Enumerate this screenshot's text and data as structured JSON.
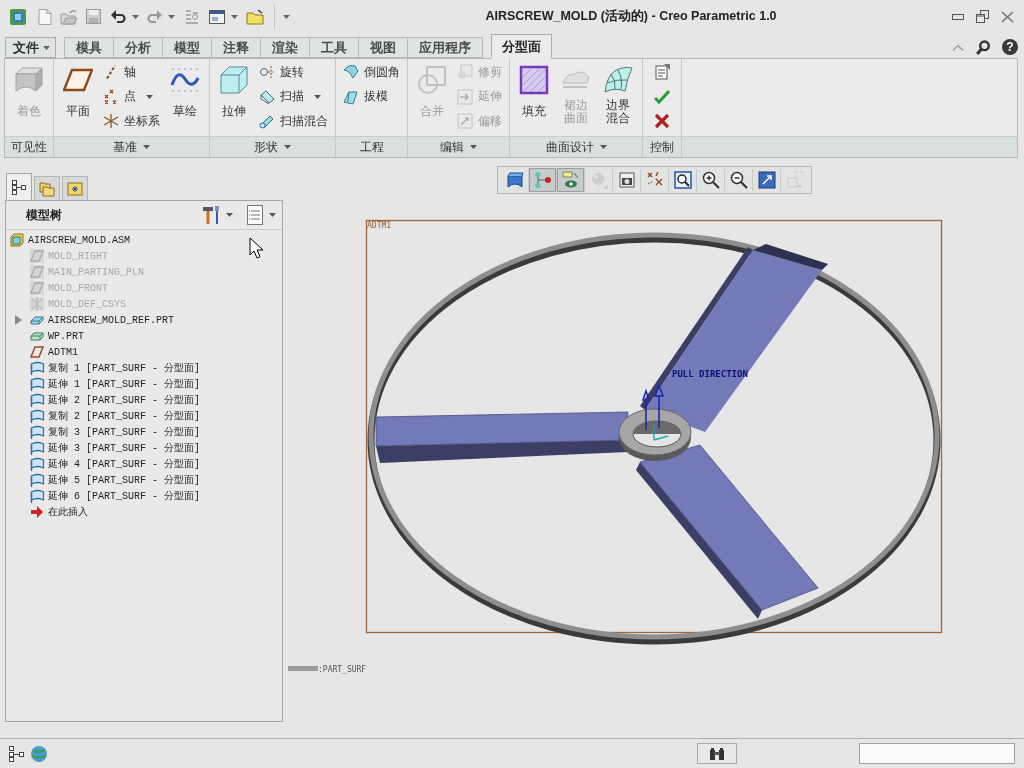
{
  "window": {
    "title": "AIRSCREW_MOLD (活动的) - Creo Parametric 1.0"
  },
  "ribbon_tabs": {
    "file_menu": "文件",
    "tabs": [
      {
        "label": "模具",
        "selected": false
      },
      {
        "label": "分析",
        "selected": false
      },
      {
        "label": "模型",
        "selected": false
      },
      {
        "label": "注释",
        "selected": false
      },
      {
        "label": "渲染",
        "selected": false
      },
      {
        "label": "工具",
        "selected": false
      },
      {
        "label": "视图",
        "selected": false
      },
      {
        "label": "应用程序",
        "selected": false
      },
      {
        "label": "分型面",
        "selected": true
      }
    ],
    "help": "?"
  },
  "ribbon": {
    "groups": [
      {
        "label": "可见性",
        "menu": false,
        "controls": [
          {
            "kind": "large",
            "label": "着色",
            "disabled": true,
            "menu": false
          }
        ]
      },
      {
        "label": "基准",
        "menu": true,
        "controls": [
          {
            "kind": "large",
            "label": "平面",
            "disabled": false,
            "menu": false
          },
          {
            "kind": "small",
            "label": "轴",
            "disabled": false,
            "menu": false
          },
          {
            "kind": "small",
            "label": "点",
            "disabled": false,
            "menu": true
          },
          {
            "kind": "small",
            "label": "坐标系",
            "disabled": false,
            "menu": false
          },
          {
            "kind": "large",
            "label": "草绘",
            "disabled": false,
            "menu": false
          }
        ]
      },
      {
        "label": "形状",
        "menu": true,
        "controls": [
          {
            "kind": "large",
            "label": "拉伸",
            "disabled": false,
            "menu": false
          },
          {
            "kind": "small",
            "label": "旋转",
            "disabled": false,
            "menu": false
          },
          {
            "kind": "small",
            "label": "扫描",
            "disabled": false,
            "menu": true
          },
          {
            "kind": "small",
            "label": "扫描混合",
            "disabled": false,
            "menu": false
          }
        ]
      },
      {
        "label": "工程",
        "menu": false,
        "controls": [
          {
            "kind": "small",
            "label": "倒圆角",
            "disabled": false,
            "menu": false
          },
          {
            "kind": "small",
            "label": "拔模",
            "disabled": false,
            "menu": false
          }
        ]
      },
      {
        "label": "编辑",
        "menu": true,
        "controls": [
          {
            "kind": "large",
            "label": "合并",
            "disabled": true,
            "menu": false
          },
          {
            "kind": "small",
            "label": "修剪",
            "disabled": true,
            "menu": false
          },
          {
            "kind": "small",
            "label": "延伸",
            "disabled": true,
            "menu": false
          },
          {
            "kind": "small",
            "label": "偏移",
            "disabled": true,
            "menu": false
          }
        ]
      },
      {
        "label": "曲面设计",
        "menu": true,
        "controls": [
          {
            "kind": "large",
            "label": "填充",
            "disabled": false,
            "menu": false
          },
          {
            "kind": "large",
            "label": "裙边曲面",
            "disabled": true,
            "menu": false
          },
          {
            "kind": "large",
            "label": "边界混合",
            "disabled": false,
            "menu": false
          }
        ]
      },
      {
        "label": "控制",
        "menu": false,
        "controls": [
          {
            "kind": "icon",
            "disabled": false,
            "menu": false
          },
          {
            "kind": "icon",
            "disabled": false,
            "menu": false
          },
          {
            "kind": "icon",
            "disabled": false,
            "menu": false
          }
        ]
      }
    ]
  },
  "navigator": {
    "tabs": [
      {
        "selected": true
      },
      {
        "selected": false
      },
      {
        "selected": false
      }
    ],
    "title": "模型树",
    "tree": [
      {
        "label": "AIRSCREW_MOLD.ASM",
        "kind": "assembly",
        "dimmed": false,
        "children": [
          {
            "label": "MOLD_RIGHT",
            "kind": "datum_plane",
            "dimmed": true
          },
          {
            "label": "MAIN_PARTING_PLN",
            "kind": "datum_plane",
            "dimmed": true
          },
          {
            "label": "MOLD_FRONT",
            "kind": "datum_plane",
            "dimmed": true
          },
          {
            "label": "MOLD_DEF_CSYS",
            "kind": "csys",
            "dimmed": true
          },
          {
            "label": "AIRSCREW_MOLD_REF.PRT",
            "kind": "part",
            "dimmed": false,
            "expanded": false
          },
          {
            "label": "WP.PRT",
            "kind": "workpiece",
            "dimmed": false
          },
          {
            "label": "ADTM1",
            "kind": "plane",
            "dimmed": false
          },
          {
            "label": "复制 1 [PART_SURF - 分型面]",
            "kind": "surface",
            "dimmed": false
          },
          {
            "label": "延伸 1 [PART_SURF - 分型面]",
            "kind": "surface",
            "dimmed": false
          },
          {
            "label": "延伸 2 [PART_SURF - 分型面]",
            "kind": "surface",
            "dimmed": false
          },
          {
            "label": "复制 2 [PART_SURF - 分型面]",
            "kind": "surface",
            "dimmed": false
          },
          {
            "label": "复制 3 [PART_SURF - 分型面]",
            "kind": "surface",
            "dimmed": false
          },
          {
            "label": "延伸 3 [PART_SURF - 分型面]",
            "kind": "surface",
            "dimmed": false
          },
          {
            "label": "延伸 4 [PART_SURF - 分型面]",
            "kind": "surface",
            "dimmed": false
          },
          {
            "label": "延伸 5 [PART_SURF - 分型面]",
            "kind": "surface",
            "dimmed": false
          },
          {
            "label": "延伸 6 [PART_SURF - 分型面]",
            "kind": "surface",
            "dimmed": false
          },
          {
            "label": "在此插入",
            "kind": "insert",
            "dimmed": false
          }
        ]
      }
    ]
  },
  "view_toolbar": [
    {
      "on": false,
      "disabled": false
    },
    {
      "on": true,
      "disabled": false
    },
    {
      "on": true,
      "disabled": false
    },
    {
      "on": false,
      "disabled": true
    },
    {
      "on": false,
      "disabled": false
    },
    {
      "on": false,
      "disabled": false
    },
    {
      "on": false,
      "disabled": false
    },
    {
      "on": false,
      "disabled": false
    },
    {
      "on": false,
      "disabled": false
    },
    {
      "on": false,
      "disabled": false
    },
    {
      "on": false,
      "disabled": true
    }
  ],
  "graphics": {
    "datum_label": "ADTM1",
    "pull_direction_label": "PULL DIRECTION",
    "surface_label": ":PART_SURF"
  }
}
